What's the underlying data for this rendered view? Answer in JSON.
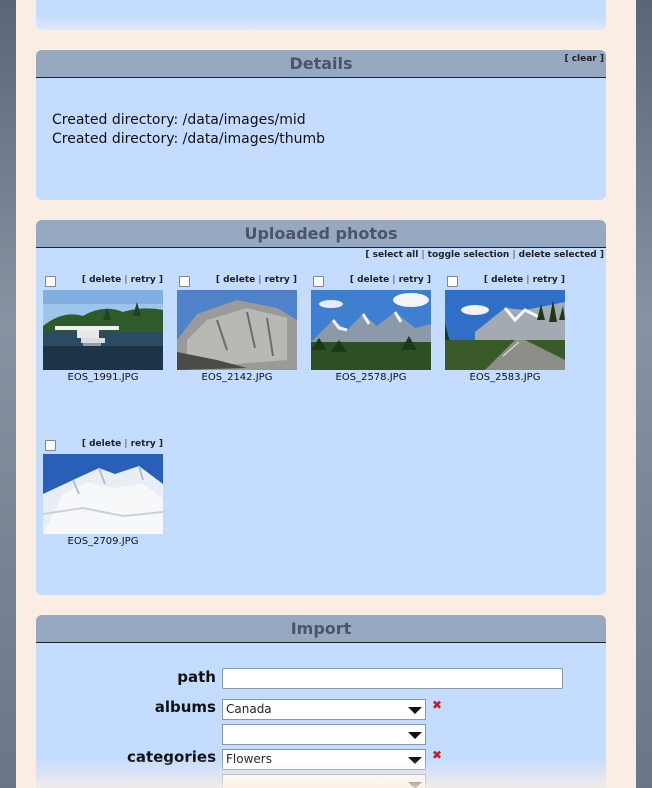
{
  "details": {
    "title": "Details",
    "clear_link": "clear",
    "lines": [
      "Created directory: /data/images/mid",
      "Created directory: /data/images/thumb"
    ]
  },
  "uploaded": {
    "title": "Uploaded photos",
    "toolbar": {
      "select_all": "select all",
      "toggle_selection": "toggle selection",
      "delete_selected": "delete selected"
    },
    "photo_links": {
      "delete": "delete",
      "retry": "retry"
    },
    "photos": [
      {
        "filename": "EOS_1991.JPG",
        "scene": "lake-seaplane"
      },
      {
        "filename": "EOS_2142.JPG",
        "scene": "granite-rock"
      },
      {
        "filename": "EOS_2578.JPG",
        "scene": "mountain-valley"
      },
      {
        "filename": "EOS_2583.JPG",
        "scene": "mountain-road"
      },
      {
        "filename": "EOS_2709.JPG",
        "scene": "snowy-peak"
      }
    ]
  },
  "import": {
    "title": "Import",
    "path_label": "path",
    "path_value": "",
    "albums_label": "albums",
    "albums_selected": "Canada",
    "albums_second": "",
    "categories_label": "categories",
    "categories_selected": "Flowers"
  },
  "colors": {
    "panel_bg": "#c4dcff",
    "header_bg": "#97a9c0",
    "page_bg": "#faeee4",
    "remove": "#c02020"
  }
}
